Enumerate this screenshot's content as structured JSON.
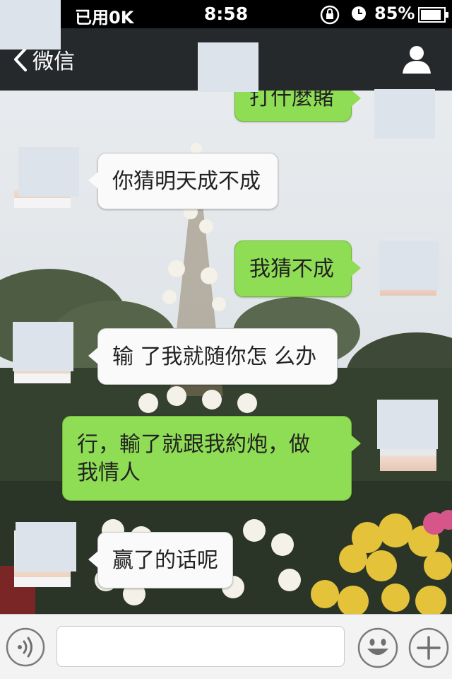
{
  "status_bar": {
    "carrier": "已用0K",
    "time": "8:58",
    "battery": "85%"
  },
  "nav": {
    "back_label": "微信"
  },
  "messages": [
    {
      "side": "out",
      "text": "打什麼賭"
    },
    {
      "side": "in",
      "text": "你猜明天成不成"
    },
    {
      "side": "out",
      "text": "我猜不成"
    },
    {
      "side": "in",
      "text": "输 了我就随你怎 么办"
    },
    {
      "side": "out",
      "text": "行，輸了就跟我約炮，做我情人"
    },
    {
      "side": "in",
      "text": "赢了的话呢"
    }
  ],
  "input": {
    "value": "",
    "placeholder": ""
  },
  "icons": {
    "back": "chevron-left-icon",
    "profile": "user-icon",
    "voice": "voice-icon",
    "emoji": "smiley-icon",
    "more": "plus-icon",
    "orientation_lock": "rotation-lock-icon",
    "alarm": "alarm-icon",
    "battery": "battery-icon"
  },
  "colors": {
    "outgoing_bubble": "#8fdd55",
    "incoming_bubble": "#fafafa",
    "nav_bar": "#26292c"
  }
}
